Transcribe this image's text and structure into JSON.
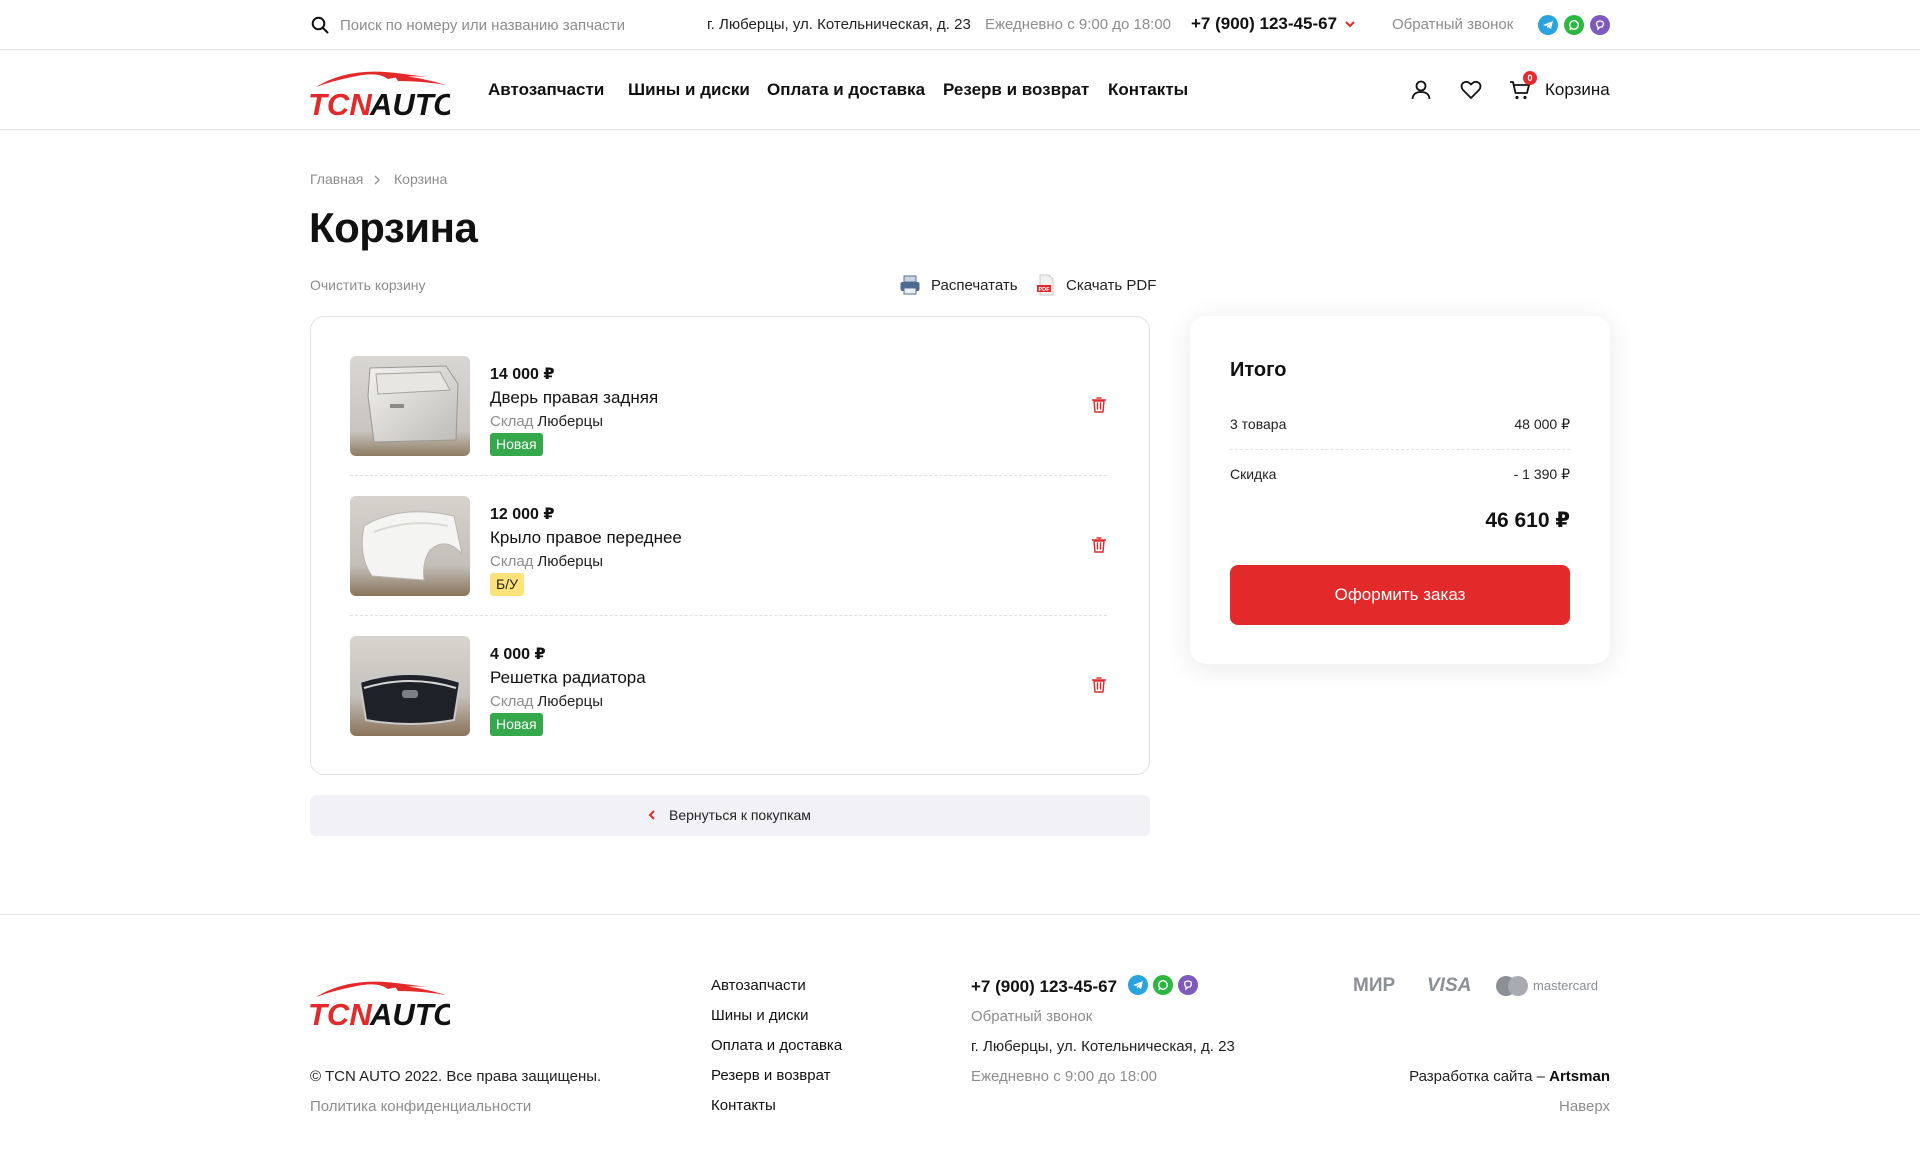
{
  "topbar": {
    "search_placeholder": "Поиск по номеру или названию запчасти",
    "address": "г. Люберцы, ул. Котельническая, д. 23",
    "hours": "Ежедневно с 9:00 до 18:00",
    "phone": "+7 (900) 123-45-67",
    "callback": "Обратный звонок"
  },
  "header": {
    "logo_text_red": "TCN",
    "logo_text_black": "AUTO",
    "nav": [
      "Автозапчасти",
      "Шины и диски",
      "Оплата и доставка",
      "Резерв и возврат",
      "Контакты"
    ],
    "cart_count": "0",
    "cart_label": "Корзина"
  },
  "breadcrumb": [
    "Главная",
    "Корзина"
  ],
  "page_title": "Корзина",
  "actions": {
    "clear": "Очистить корзину",
    "print": "Распечатать",
    "pdf": "Скачать PDF",
    "pdf_icon_text": "PDF"
  },
  "cart": {
    "stock_label": "Склад",
    "items": [
      {
        "price": "14 000 ₽",
        "name": "Дверь правая задняя",
        "stock": "Люберцы",
        "condition": "Новая",
        "condition_type": "new"
      },
      {
        "price": "12 000 ₽",
        "name": "Крыло правое переднее",
        "stock": "Люберцы",
        "condition": "Б/У",
        "condition_type": "used"
      },
      {
        "price": "4 000 ₽",
        "name": "Решетка радиатора",
        "stock": "Люберцы",
        "condition": "Новая",
        "condition_type": "new"
      }
    ],
    "back_label": "Вернуться к покупкам"
  },
  "summary": {
    "title": "Итого",
    "items_label": "3 товара",
    "items_value": "48 000 ₽",
    "discount_label": "Скидка",
    "discount_value": "- 1 390 ₽",
    "total": "46 610 ₽",
    "order_button": "Оформить заказ"
  },
  "footer": {
    "copyright": "© TCN AUTO 2022. Все права защищены.",
    "policy": "Политика конфиденциальности",
    "links": [
      "Автозапчасти",
      "Шины и диски",
      "Оплата и доставка",
      "Резерв и возврат",
      "Контакты"
    ],
    "phone": "+7 (900) 123-45-67",
    "callback": "Обратный звонок",
    "address": "г. Люберцы, ул. Котельническая, д. 23",
    "hours": "Ежедневно с 9:00 до 18:00",
    "payments": [
      "МИР",
      "VISA",
      "mastercard"
    ],
    "dev_prefix": "Разработка сайта – ",
    "dev_name": "Artsman",
    "to_top": "Наверх"
  },
  "colors": {
    "accent_red": "#e22a2a",
    "badge_new": "#34a84a",
    "badge_used": "#ffe37a",
    "telegram": "#2aa3de",
    "whatsapp": "#2bb741",
    "viber": "#7d5bbe"
  }
}
